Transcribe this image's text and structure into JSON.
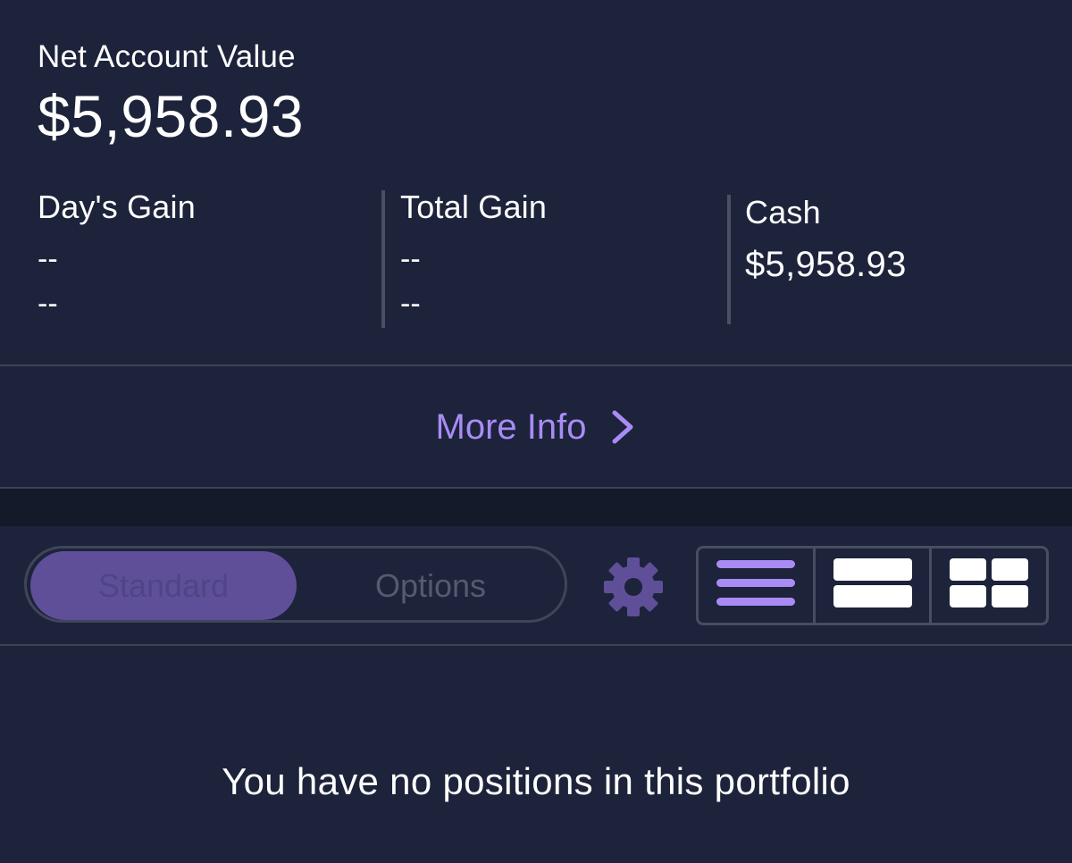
{
  "account": {
    "net_account_value_label": "Net Account Value",
    "net_account_value": "$5,958.93"
  },
  "stats": {
    "days_gain": {
      "label": "Day's Gain",
      "value": "--",
      "percent": "--"
    },
    "total_gain": {
      "label": "Total Gain",
      "value": "--",
      "percent": "--"
    },
    "cash": {
      "label": "Cash",
      "value": "$5,958.93"
    }
  },
  "more_info": {
    "label": "More Info"
  },
  "tabs": {
    "standard": "Standard",
    "options": "Options",
    "selected": "standard"
  },
  "icons": {
    "gear": "gear-icon",
    "view_list": "list-view-icon",
    "view_rows": "rows-view-icon",
    "view_grid": "grid-view-icon",
    "more_info_chevron": "chevron-right-icon"
  },
  "empty_state": {
    "message": "You have no positions in this portfolio"
  },
  "colors": {
    "background": "#1c233a",
    "accent": "#a98bf5",
    "selected_tab": "#5f4f99"
  }
}
